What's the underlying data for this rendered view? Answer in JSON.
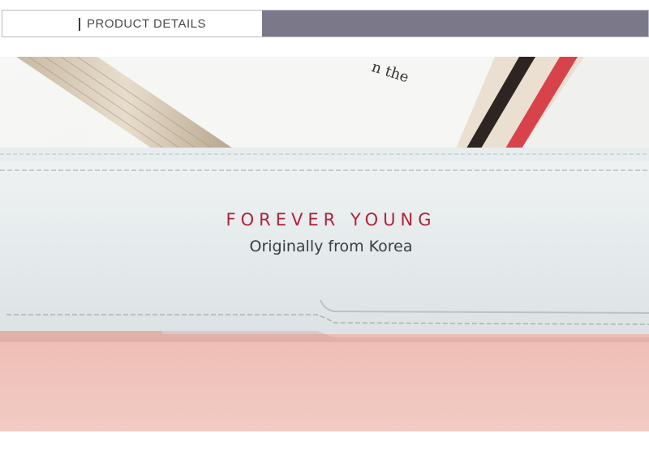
{
  "header": {
    "title": "PRODUCT DETAILS",
    "accent_color": "#7a7889"
  },
  "photo": {
    "book_text": "n the",
    "brand": "FOREVER YOUNG",
    "tagline": "Originally from Korea",
    "colors": {
      "flap": "#e6ebec",
      "body": "#f0c6c0",
      "brand_text": "#b0233a",
      "tagline_text": "#3a3d45"
    }
  }
}
